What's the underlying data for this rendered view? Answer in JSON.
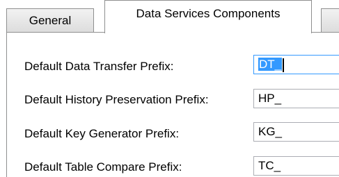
{
  "tabs": [
    {
      "label": "General",
      "selected": false
    },
    {
      "label": "Data Services Components",
      "selected": true
    },
    {
      "label": "",
      "selected": false
    }
  ],
  "fields": [
    {
      "label": "Default Data Transfer Prefix:",
      "value": "DT_",
      "focused": true
    },
    {
      "label": "Default History Preservation Prefix:",
      "value": "HP_",
      "focused": false
    },
    {
      "label": "Default Key Generator Prefix:",
      "value": "KG_",
      "focused": false
    },
    {
      "label": "Default Table Compare Prefix:",
      "value": "TC_",
      "focused": false
    }
  ],
  "colors": {
    "selection": "#3399ff",
    "border": "#8e8f8f",
    "input_border": "#abadb3"
  }
}
